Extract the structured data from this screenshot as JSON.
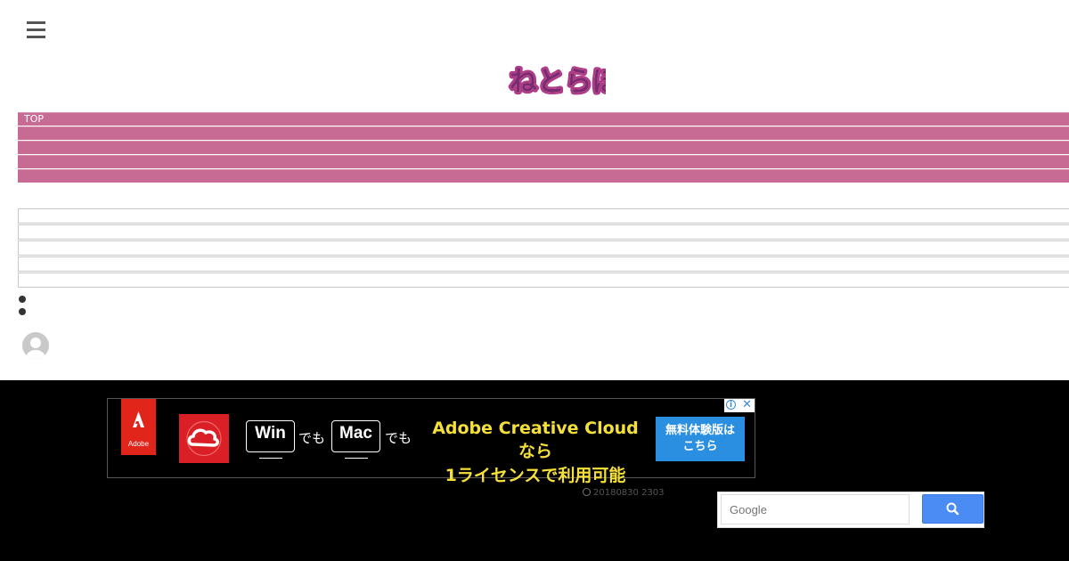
{
  "header": {
    "menu_icon": "hamburger-menu-icon",
    "logo_text": "ねとらぼ"
  },
  "nav_pink": {
    "items": [
      {
        "label": "TOP"
      },
      {
        "label": ""
      },
      {
        "label": ""
      },
      {
        "label": ""
      },
      {
        "label": ""
      }
    ],
    "color": "#c86b94"
  },
  "nav_white": {
    "items": [
      {
        "label": ""
      },
      {
        "label": ""
      },
      {
        "label": ""
      },
      {
        "label": ""
      },
      {
        "label": ""
      }
    ]
  },
  "avatar_icon": "user-avatar-icon",
  "footer": {
    "ad": {
      "adobe_logo": "Adobe",
      "cc_icon": "creative-cloud-icon",
      "win_label": "Win",
      "mac_label": "Mac",
      "demo_1": "でも",
      "demo_2": "でも",
      "headline_1": "Adobe Creative Cloudなら",
      "headline_2": "1ライセンスで利用可能",
      "cta_1": "無料体験版は",
      "cta_2": "こちら",
      "cta_color": "#2a8fe0",
      "headline_color": "#f5e03a"
    },
    "timestamp": "20180830 2303",
    "search": {
      "placeholder": "Google",
      "button_icon": "search-icon"
    }
  }
}
